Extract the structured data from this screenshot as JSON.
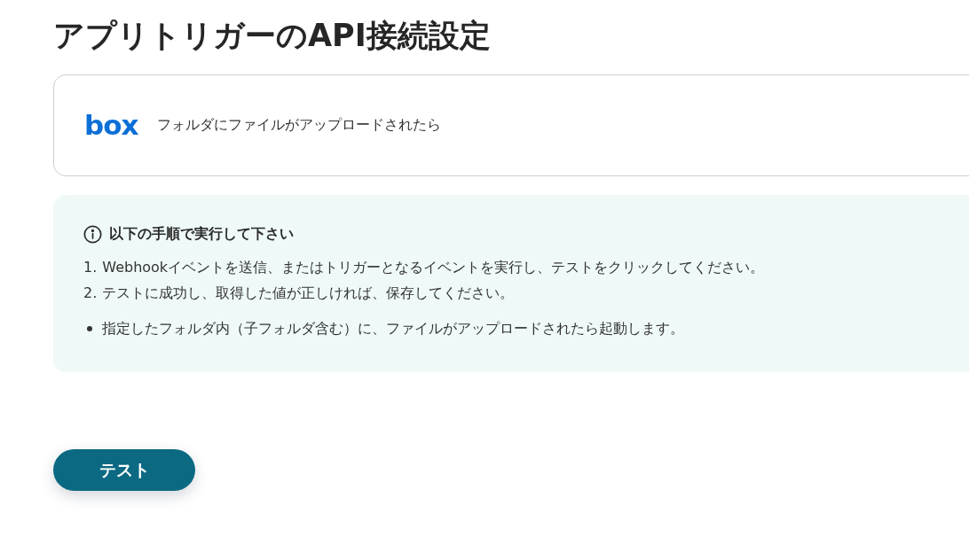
{
  "title": "アプリトリガーのAPI接続設定",
  "trigger": {
    "logo": "box",
    "label": "フォルダにファイルがアップロードされたら"
  },
  "instructions": {
    "title": "以下の手順で実行して下さい",
    "steps": [
      {
        "number": "1.",
        "text": "Webhookイベントを送信、またはトリガーとなるイベントを実行し、テストをクリックしてください。"
      },
      {
        "number": "2.",
        "text": "テストに成功し、取得した値が正しければ、保存してください。"
      }
    ],
    "notes": [
      "指定したフォルダ内（子フォルダ含む）に、ファイルがアップロードされたら起動します。"
    ]
  },
  "button": {
    "label": "テスト"
  }
}
